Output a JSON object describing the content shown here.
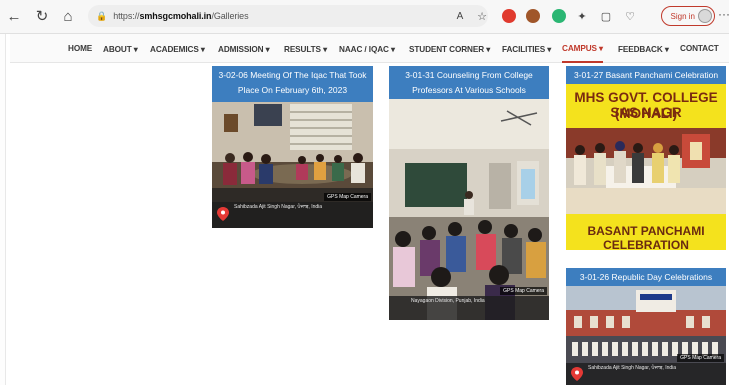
{
  "browser": {
    "url_prefix": "https://",
    "url_host": "smhsgcmohali.in",
    "url_path": "/Galleries",
    "signin_label": "Sign in",
    "more_glyph": "···"
  },
  "nav": {
    "items": [
      {
        "label": "HOME"
      },
      {
        "label": "ABOUT ▾"
      },
      {
        "label": "ACADEMICS ▾"
      },
      {
        "label": "ADMISSION ▾"
      },
      {
        "label": "RESULTS ▾"
      },
      {
        "label": "NAAC / IQAC ▾"
      },
      {
        "label": "STUDENT CORNER ▾"
      },
      {
        "label": "FACILITIES ▾"
      },
      {
        "label": "CAMPUS ▾",
        "active": true
      },
      {
        "label": "FEEDBACK ▾"
      },
      {
        "label": "CONTACT"
      }
    ]
  },
  "gallery": {
    "card1": {
      "caption": "3-02-06 Meeting Of The Iqac That Took Place On February 6th, 2023",
      "geo_tag": "GPS Map Camera",
      "geo_text": "Sahibzada Ajit Singh Nagar, ਪੰਜਾਬ, India"
    },
    "card2": {
      "caption": "3-01-31 Counseling From College Professors At Various Schools",
      "geo_tag": "GPS Map Camera",
      "geo_text": "Nayagaon Division, Punjab, India"
    },
    "card3": {
      "caption": "3-01-27 Basant Panchami Celebration",
      "poster_title_line1": "MHS GOVT. COLLEGE SAS NAGR",
      "poster_title_line2": "(MOHALI)",
      "poster_bottom": "BASANT PANCHAMI CELEBRATION"
    },
    "card4": {
      "caption": "3-01-26 Republic Day Celebrations",
      "geo_tag": "GPS Map Camera",
      "geo_text": "Sahibzada Ajit Singh Nagar, ਪੰਜਾਬ, India"
    }
  },
  "colors": {
    "caption_bg": "#3d7ebf",
    "active_nav": "#c0392b",
    "poster_yellow": "#f4e21d"
  }
}
